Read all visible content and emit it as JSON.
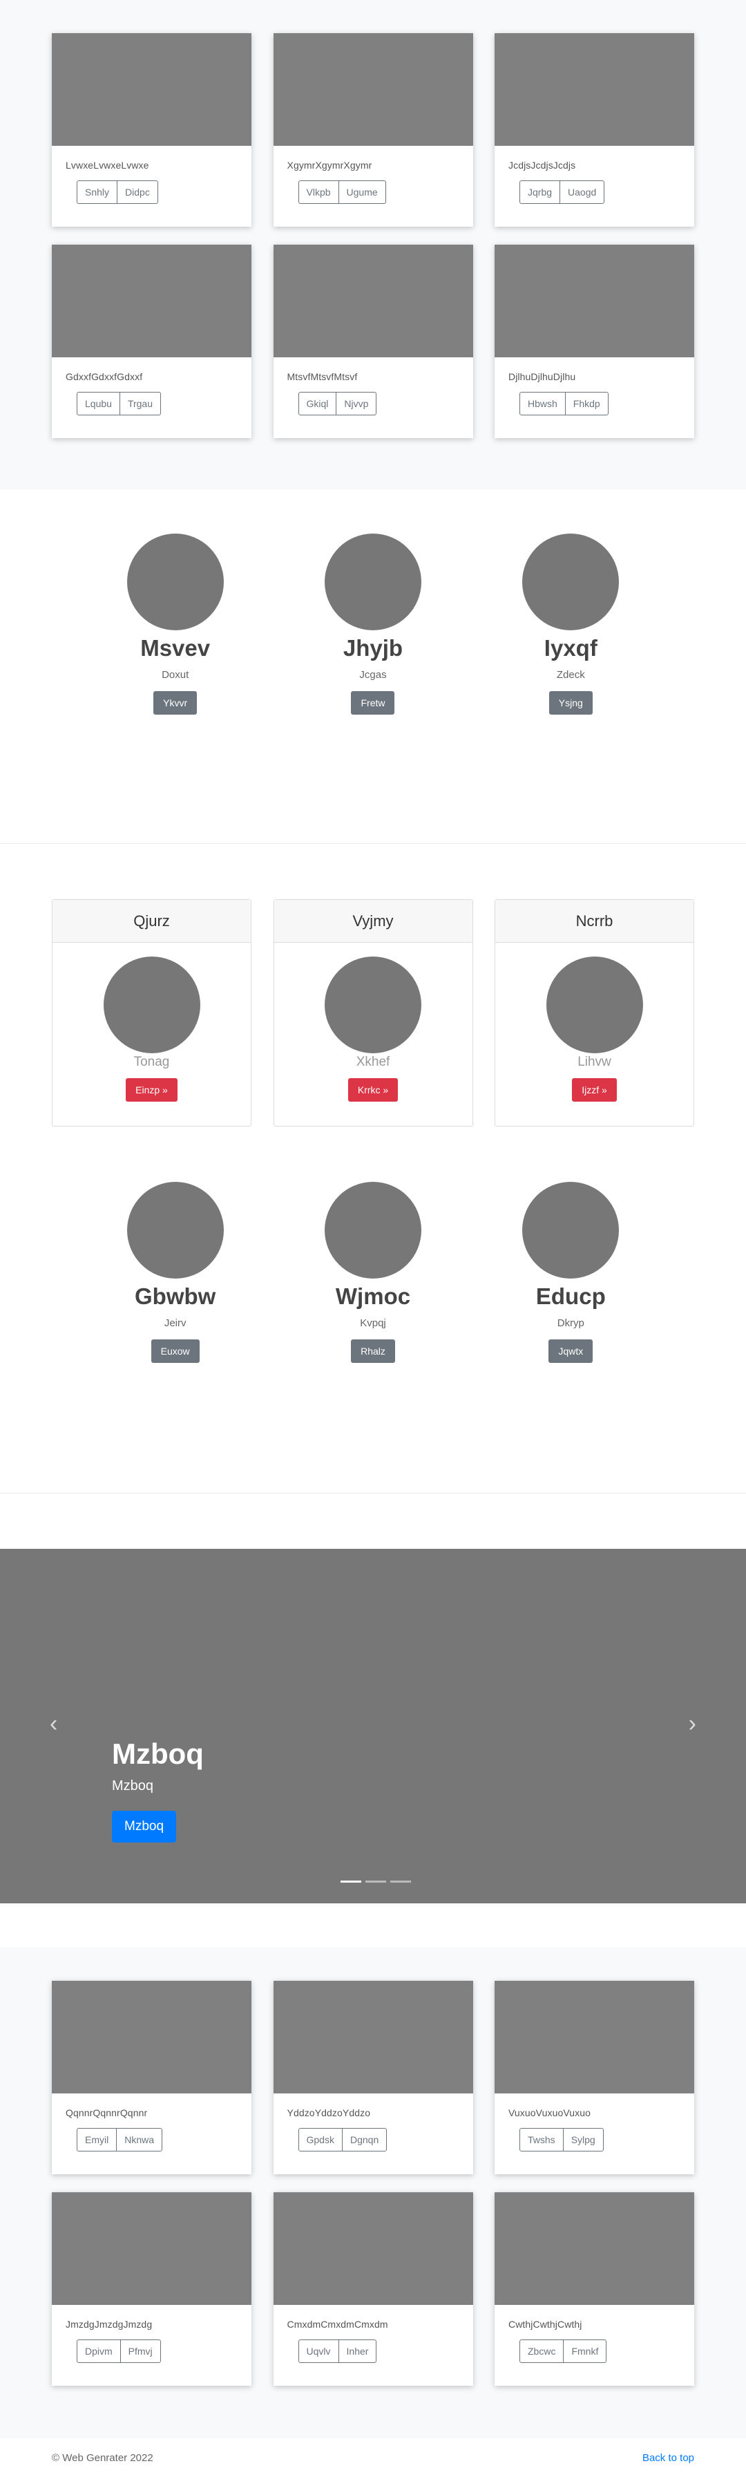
{
  "album_top": {
    "cards": [
      {
        "text": "LvwxeLvwxeLvwxe",
        "buttons": [
          "Snhly",
          "Didpc"
        ]
      },
      {
        "text": "XgymrXgymrXgymr",
        "buttons": [
          "Vlkpb",
          "Ugume"
        ]
      },
      {
        "text": "JcdjsJcdjsJcdjs",
        "buttons": [
          "Jqrbg",
          "Uaogd"
        ]
      },
      {
        "text": "GdxxfGdxxfGdxxf",
        "buttons": [
          "Lqubu",
          "Trgau"
        ]
      },
      {
        "text": "MtsvfMtsvfMtsvf",
        "buttons": [
          "Gkiql",
          "Njvvp"
        ]
      },
      {
        "text": "DjlhuDjlhuDjlhu",
        "buttons": [
          "Hbwsh",
          "Fhkdp"
        ]
      }
    ]
  },
  "profiles_1": [
    {
      "name": "Msvev",
      "sub": "Doxut",
      "button": "Ykvvr"
    },
    {
      "name": "Jhyjb",
      "sub": "Jcgas",
      "button": "Fretw"
    },
    {
      "name": "Iyxqf",
      "sub": "Zdeck",
      "button": "Ysjng"
    }
  ],
  "panels": [
    {
      "title": "Qjurz",
      "sub": "Tonag",
      "button": "Einzp »"
    },
    {
      "title": "Vyjmy",
      "sub": "Xkhef",
      "button": "Krrkc »"
    },
    {
      "title": "Ncrrb",
      "sub": "Lihvw",
      "button": "Ijzzf »"
    }
  ],
  "profiles_2": [
    {
      "name": "Gbwbw",
      "sub": "Jeirv",
      "button": "Euxow"
    },
    {
      "name": "Wjmoc",
      "sub": "Kvpqj",
      "button": "Rhalz"
    },
    {
      "name": "Educp",
      "sub": "Dkryp",
      "button": "Jqwtx"
    }
  ],
  "carousel": {
    "title": "Mzboq",
    "subtitle": "Mzboq",
    "button": "Mzboq",
    "prev_icon": "‹",
    "next_icon": "›"
  },
  "album_bottom": {
    "cards": [
      {
        "text": "QqnnrQqnnrQqnnr",
        "buttons": [
          "Emyil",
          "Nknwa"
        ]
      },
      {
        "text": "YddzoYddzoYddzo",
        "buttons": [
          "Gpdsk",
          "Dgnqn"
        ]
      },
      {
        "text": "VuxuoVuxuoVuxuo",
        "buttons": [
          "Twshs",
          "Sylpg"
        ]
      },
      {
        "text": "JmzdgJmzdgJmzdg",
        "buttons": [
          "Dpivm",
          "Pfmvj"
        ]
      },
      {
        "text": "CmxdmCmxdmCmxdm",
        "buttons": [
          "Uqvlv",
          "Inher"
        ]
      },
      {
        "text": "CwthjCwthjCwthj",
        "buttons": [
          "Zbcwc",
          "Fmnkf"
        ]
      }
    ]
  },
  "footer": {
    "copyright": "© Web Genrater 2022",
    "back_to_top": "Back to top"
  }
}
